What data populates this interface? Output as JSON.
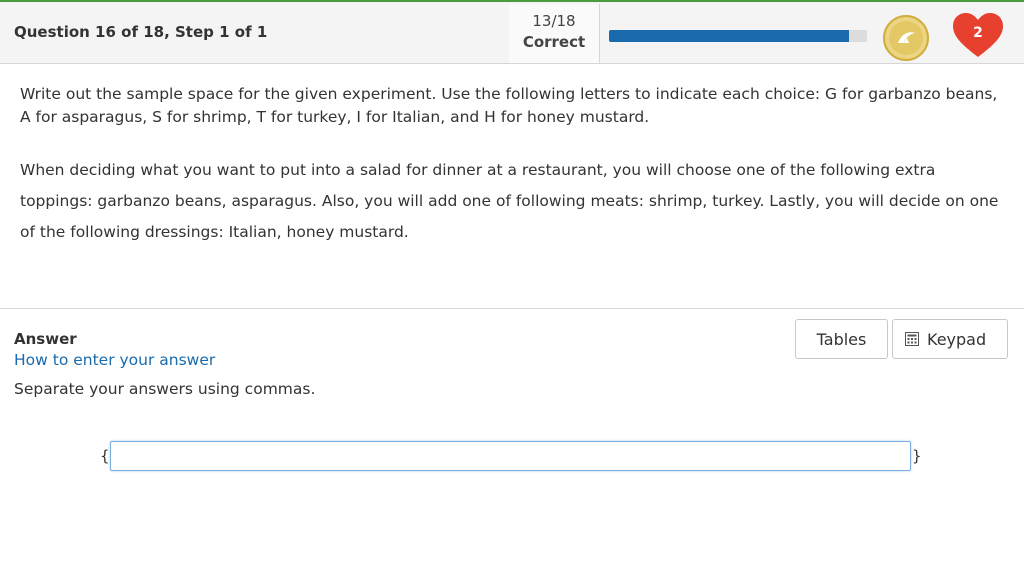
{
  "header": {
    "question_title": "Question 16 of 18, Step 1 of 1",
    "score_fraction": "13/18",
    "score_label": "Correct",
    "progress_fraction": 0.93,
    "lives": "2",
    "progress_color": "#1a6aae",
    "coin_icon": "coin-badge-icon",
    "heart_icon": "heart-icon"
  },
  "question": {
    "instructions": "Write out the sample space for the given experiment. Use the following letters to indicate each choice: G for garbanzo beans, A for asparagus, S for shrimp, T for turkey, I for Italian, and H for honey mustard.",
    "scenario": "When deciding what you want to put into a salad for dinner at a restaurant, you will choose one of the following extra toppings: garbanzo beans, asparagus.  Also, you will add one of following meats: shrimp, turkey.  Lastly, you will decide on one of the following dressings: Italian, honey mustard."
  },
  "answer": {
    "label": "Answer",
    "howto_link": "How to enter your answer",
    "separator_hint": "Separate your answers using commas.",
    "brace_open": "{",
    "brace_close": "}",
    "input_value": "",
    "tables_button": "Tables",
    "keypad_button": "Keypad"
  }
}
